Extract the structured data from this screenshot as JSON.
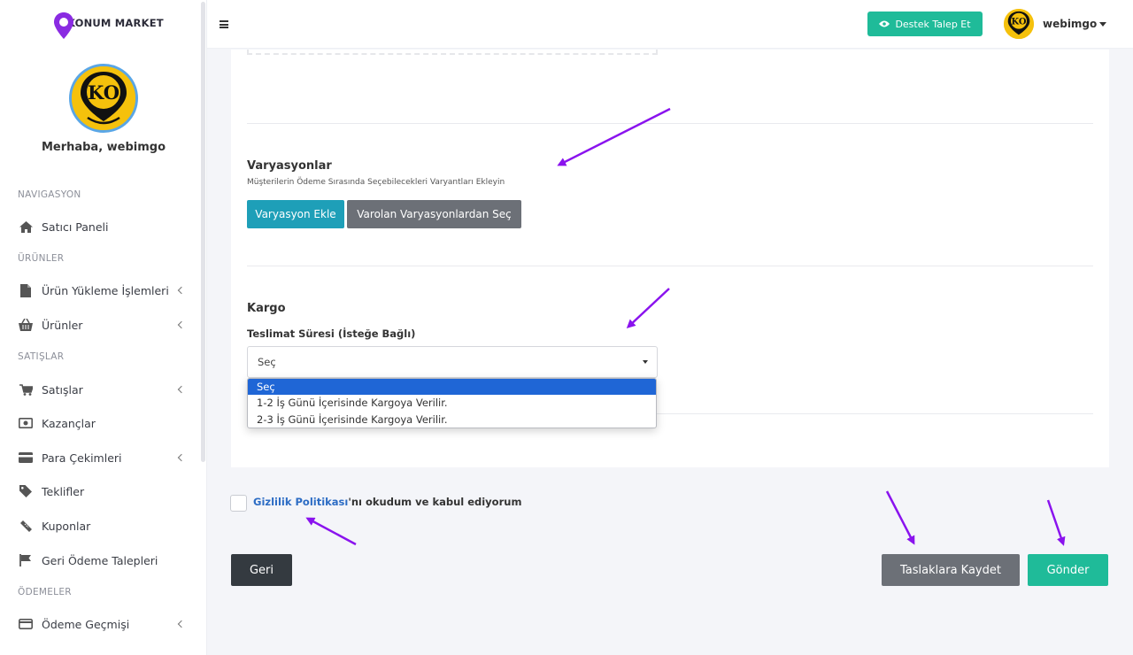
{
  "brand": {
    "name": "KONUM MARKET",
    "avatar_text": "KO"
  },
  "sidebar": {
    "greeting": "Merhaba, webimgo",
    "sections": {
      "nav": "NAVIGASYON",
      "products": "ÜRÜNLER",
      "sales": "SATIŞLAR",
      "payments": "ÖDEMELER"
    },
    "items": {
      "dashboard": "Satıcı Paneli",
      "upload": "Ürün Yükleme İşlemleri",
      "products": "Ürünler",
      "sales": "Satışlar",
      "earnings": "Kazançlar",
      "withdrawals": "Para Çekimleri",
      "offers": "Teklifler",
      "coupons": "Kuponlar",
      "refunds": "Geri Ödeme Talepleri",
      "payment_history": "Ödeme Geçmişi"
    }
  },
  "header": {
    "support_label": "Destek Talep Et",
    "user_name": "webimgo"
  },
  "variations": {
    "title": "Varyasyonlar",
    "subtitle": "Müşterilerin Ödeme Sırasında Seçebilecekleri Varyantları Ekleyin",
    "add_button": "Varyasyon Ekle",
    "choose_button": "Varolan Varyasyonlardan Seç"
  },
  "shipping": {
    "title": "Kargo",
    "field_label": "Teslimat Süresi (İsteğe Bağlı)",
    "selected": "Seç",
    "options": [
      "Seç",
      "1-2 İş Günü İçerisinde Kargoya Verilir.",
      "2-3 İş Günü İçerisinde Kargoya Verilir."
    ]
  },
  "agreement": {
    "link_text": "Gizlilik Politikası",
    "rest_text": "'nı okudum ve kabul ediyorum"
  },
  "actions": {
    "back": "Geri",
    "save_draft": "Taslaklara Kaydet",
    "submit": "Gönder"
  },
  "colors": {
    "accent_teal": "#1fbb99",
    "button_blue": "#1e9fb8",
    "button_gray": "#6c7077",
    "dark_button": "#343a40",
    "annotation_arrow": "#8a13ee"
  }
}
